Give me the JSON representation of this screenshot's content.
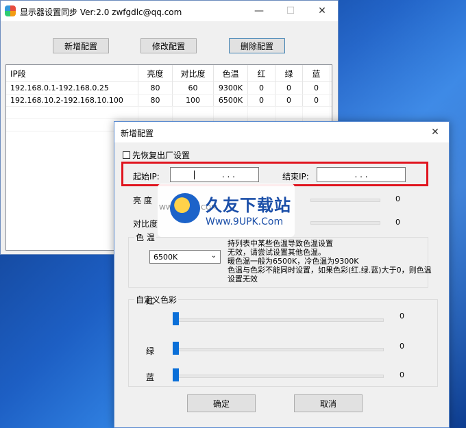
{
  "main": {
    "title": "显示器设置同步   Ver:2.0 zwfgdlc@qq.com",
    "buttons": {
      "add": "新增配置",
      "edit": "修改配置",
      "delete": "删除配置"
    },
    "columns": [
      "IP段",
      "亮度",
      "对比度",
      "色温",
      "红",
      "绿",
      "蓝"
    ],
    "rows": [
      [
        "192.168.0.1-192.168.0.25",
        "80",
        "60",
        "9300K",
        "0",
        "0",
        "0"
      ],
      [
        "192.168.10.2-192.168.10.100",
        "80",
        "100",
        "6500K",
        "0",
        "0",
        "0"
      ]
    ]
  },
  "dialog": {
    "title": "新增配置",
    "restore_label": "先恢复出厂设置",
    "start_ip_label": "起始IP:",
    "start_ip_value": ". . .",
    "end_ip_label": "结束IP:",
    "end_ip_value": ". . .",
    "brightness_label": "亮    度",
    "brightness_value": "0",
    "contrast_label": "对比度",
    "contrast_value": "0",
    "color_temp_group": "色 温",
    "color_temp_value": "6500K",
    "color_temp_note": "无效，请尝试设置其他色温。\n暖色温一般为6500K，冷色温为9300K\n色温与色彩不能同时设置，如果色彩(红.绿.蓝)大于0，则色温设置无效",
    "note_top": "持列表中某些色温导致色温设置",
    "custom_color_group": "自定义色彩",
    "red_label": "红",
    "red_value": "0",
    "green_label": "绿",
    "green_value": "0",
    "blue_label": "蓝",
    "blue_value": "0",
    "ok": "确定",
    "cancel": "取消"
  },
  "watermark": {
    "title": "久友下载站",
    "url": "Www.9UPK.Com",
    "small": "WWW.9UPK.COM"
  }
}
